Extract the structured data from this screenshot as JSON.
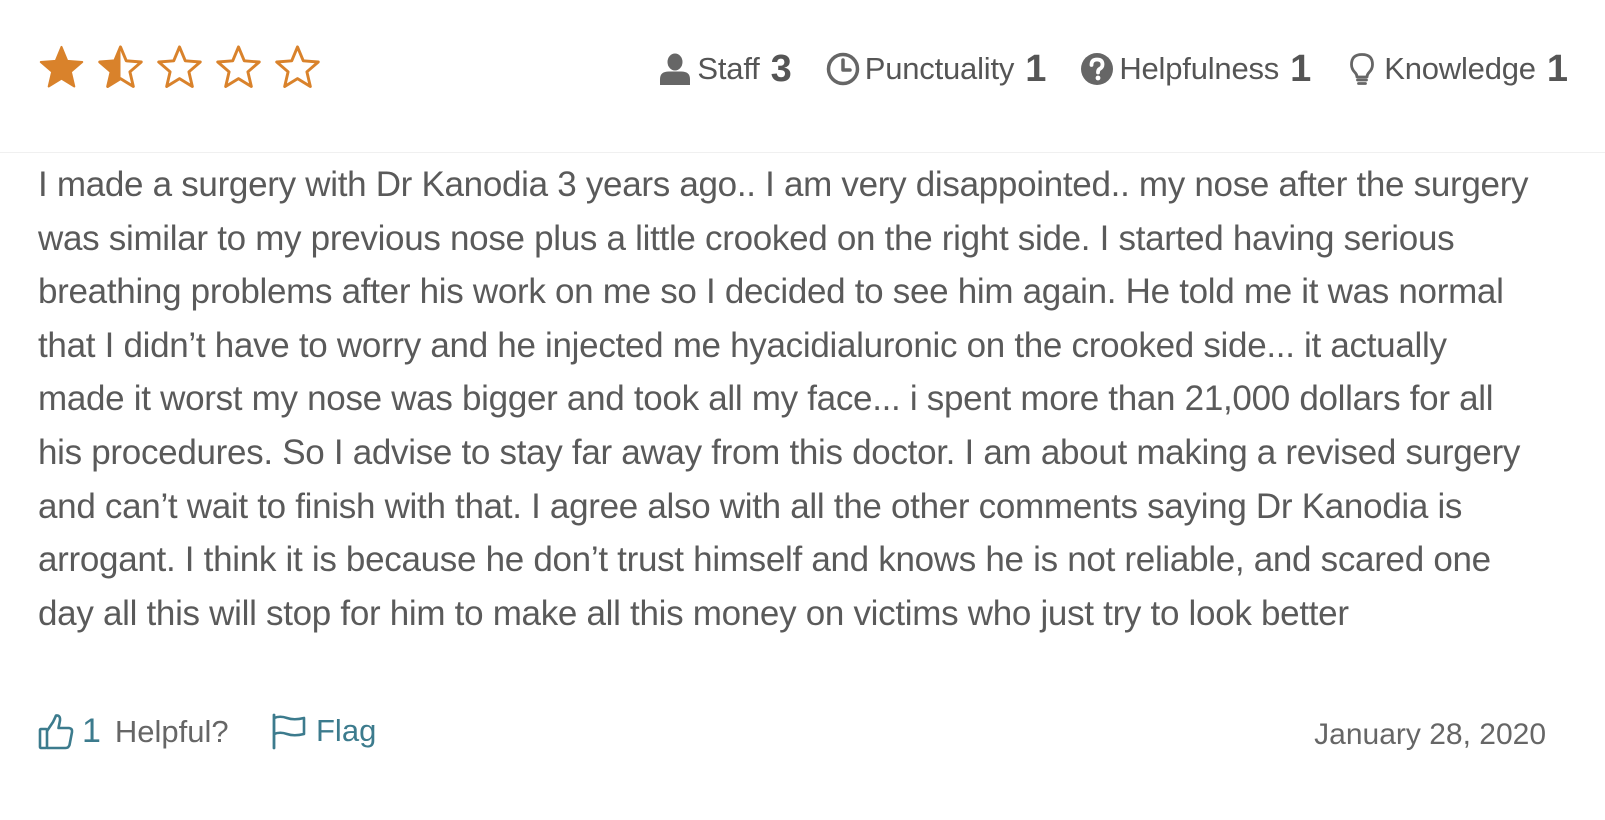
{
  "rating": {
    "overall": 1.5,
    "max": 5,
    "star_color": "#d9822b"
  },
  "scores": [
    {
      "label": "Staff",
      "value": "3",
      "icon": "user-icon"
    },
    {
      "label": "Punctuality",
      "value": "1",
      "icon": "clock-icon"
    },
    {
      "label": "Helpfulness",
      "value": "1",
      "icon": "question-circle-icon"
    },
    {
      "label": "Knowledge",
      "value": "1",
      "icon": "lightbulb-icon"
    }
  ],
  "review": {
    "text": "I made a surgery with Dr Kanodia 3 years ago.. I am very disappointed.. my nose after the surgery was similar to my previous nose plus a little crooked on the right side. I started having serious breathing problems after his work on me so I decided to see him again. He told me it was normal that I didn’t have to worry and he injected me hyacidialuronic on the crooked side... it actually made it worst my nose was bigger and took all my face... i spent more than 21,000 dollars for all his procedures. So I advise to stay far away from this doctor. I am about making a revised surgery and can’t wait to finish with that. I agree also with all the other comments saying Dr Kanodia is arrogant. I think it is because he don’t trust himself and knows he is not reliable, and scared one day all this will stop for him to make all this money on victims who just try to look better"
  },
  "footer": {
    "helpful_count": "1",
    "helpful_label": "Helpful?",
    "flag_label": "Flag",
    "date": "January 28, 2020",
    "link_color": "#3c7b8d"
  }
}
